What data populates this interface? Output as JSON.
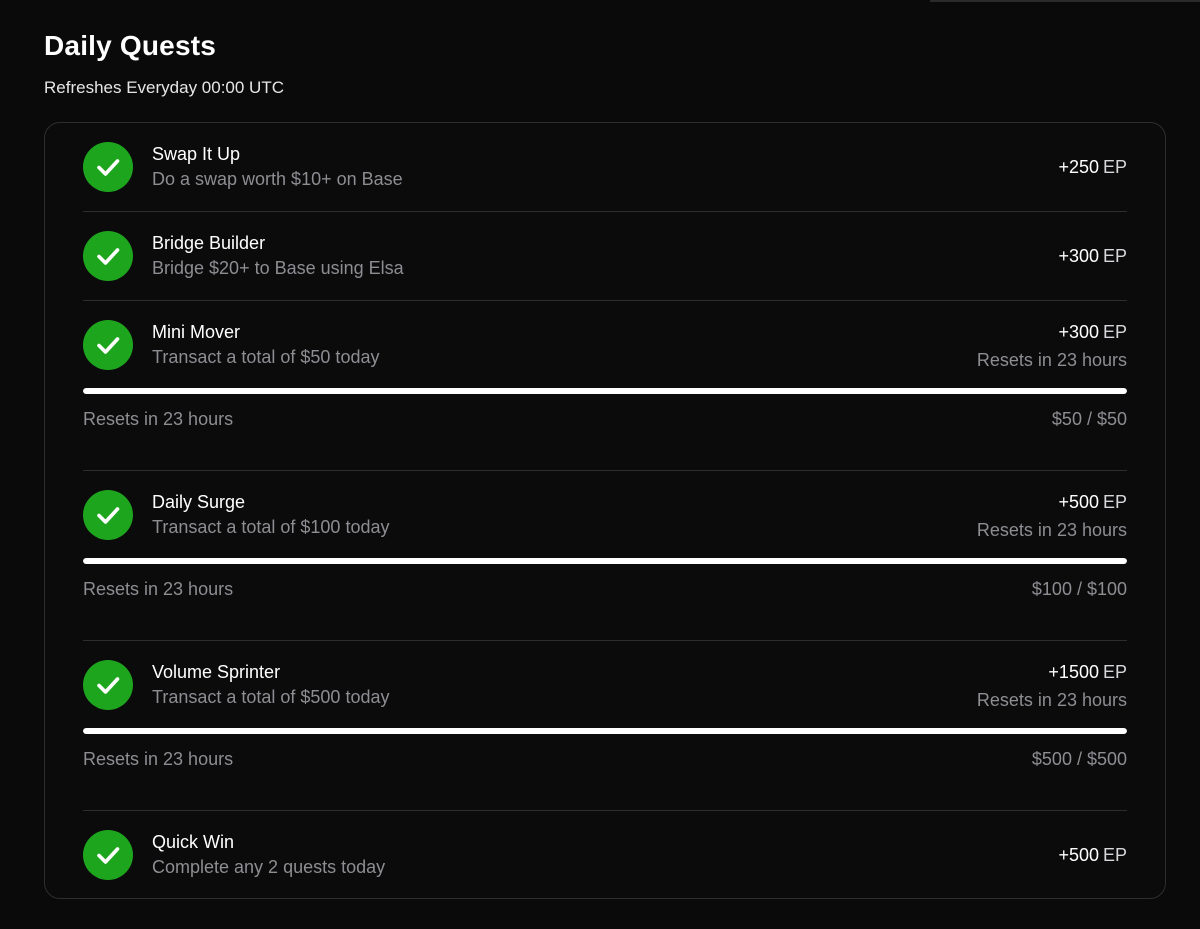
{
  "header": {
    "title": "Daily Quests",
    "subtitle": "Refreshes Everyday 00:00 UTC"
  },
  "quests": [
    {
      "name": "Swap It Up",
      "description": "Do a swap worth $10+ on Base",
      "reward": "+250",
      "unit": "EP",
      "completed": true,
      "icon": "check-icon"
    },
    {
      "name": "Bridge Builder",
      "description": "Bridge $20+ to Base using Elsa",
      "reward": "+300",
      "unit": "EP",
      "completed": true,
      "icon": "check-icon"
    },
    {
      "name": "Mini Mover",
      "description": "Transact a total of $50 today",
      "reward": "+300",
      "unit": "EP",
      "reset_right": "Resets in 23 hours",
      "reset_left": "Resets in 23 hours",
      "progress_text": "$50 / $50",
      "progress": 1.0,
      "completed": true,
      "icon": "check-icon"
    },
    {
      "name": "Daily Surge",
      "description": "Transact a total of $100 today",
      "reward": "+500",
      "unit": "EP",
      "reset_right": "Resets in 23 hours",
      "reset_left": "Resets in 23 hours",
      "progress_text": "$100 / $100",
      "progress": 1.0,
      "completed": true,
      "icon": "check-icon"
    },
    {
      "name": "Volume Sprinter",
      "description": "Transact a total of $500 today",
      "reward": "+1500",
      "unit": "EP",
      "reset_right": "Resets in 23 hours",
      "reset_left": "Resets in 23 hours",
      "progress_text": "$500 / $500",
      "progress": 1.0,
      "completed": true,
      "icon": "check-icon"
    },
    {
      "name": "Quick Win",
      "description": "Complete any 2 quests today",
      "reward": "+500",
      "unit": "EP",
      "completed": true,
      "icon": "check-icon"
    }
  ],
  "colors": {
    "background": "#0a0a0b",
    "check_green": "#1ea51e",
    "progress_fill": "#ffffff",
    "muted_text": "#8d8d92"
  }
}
